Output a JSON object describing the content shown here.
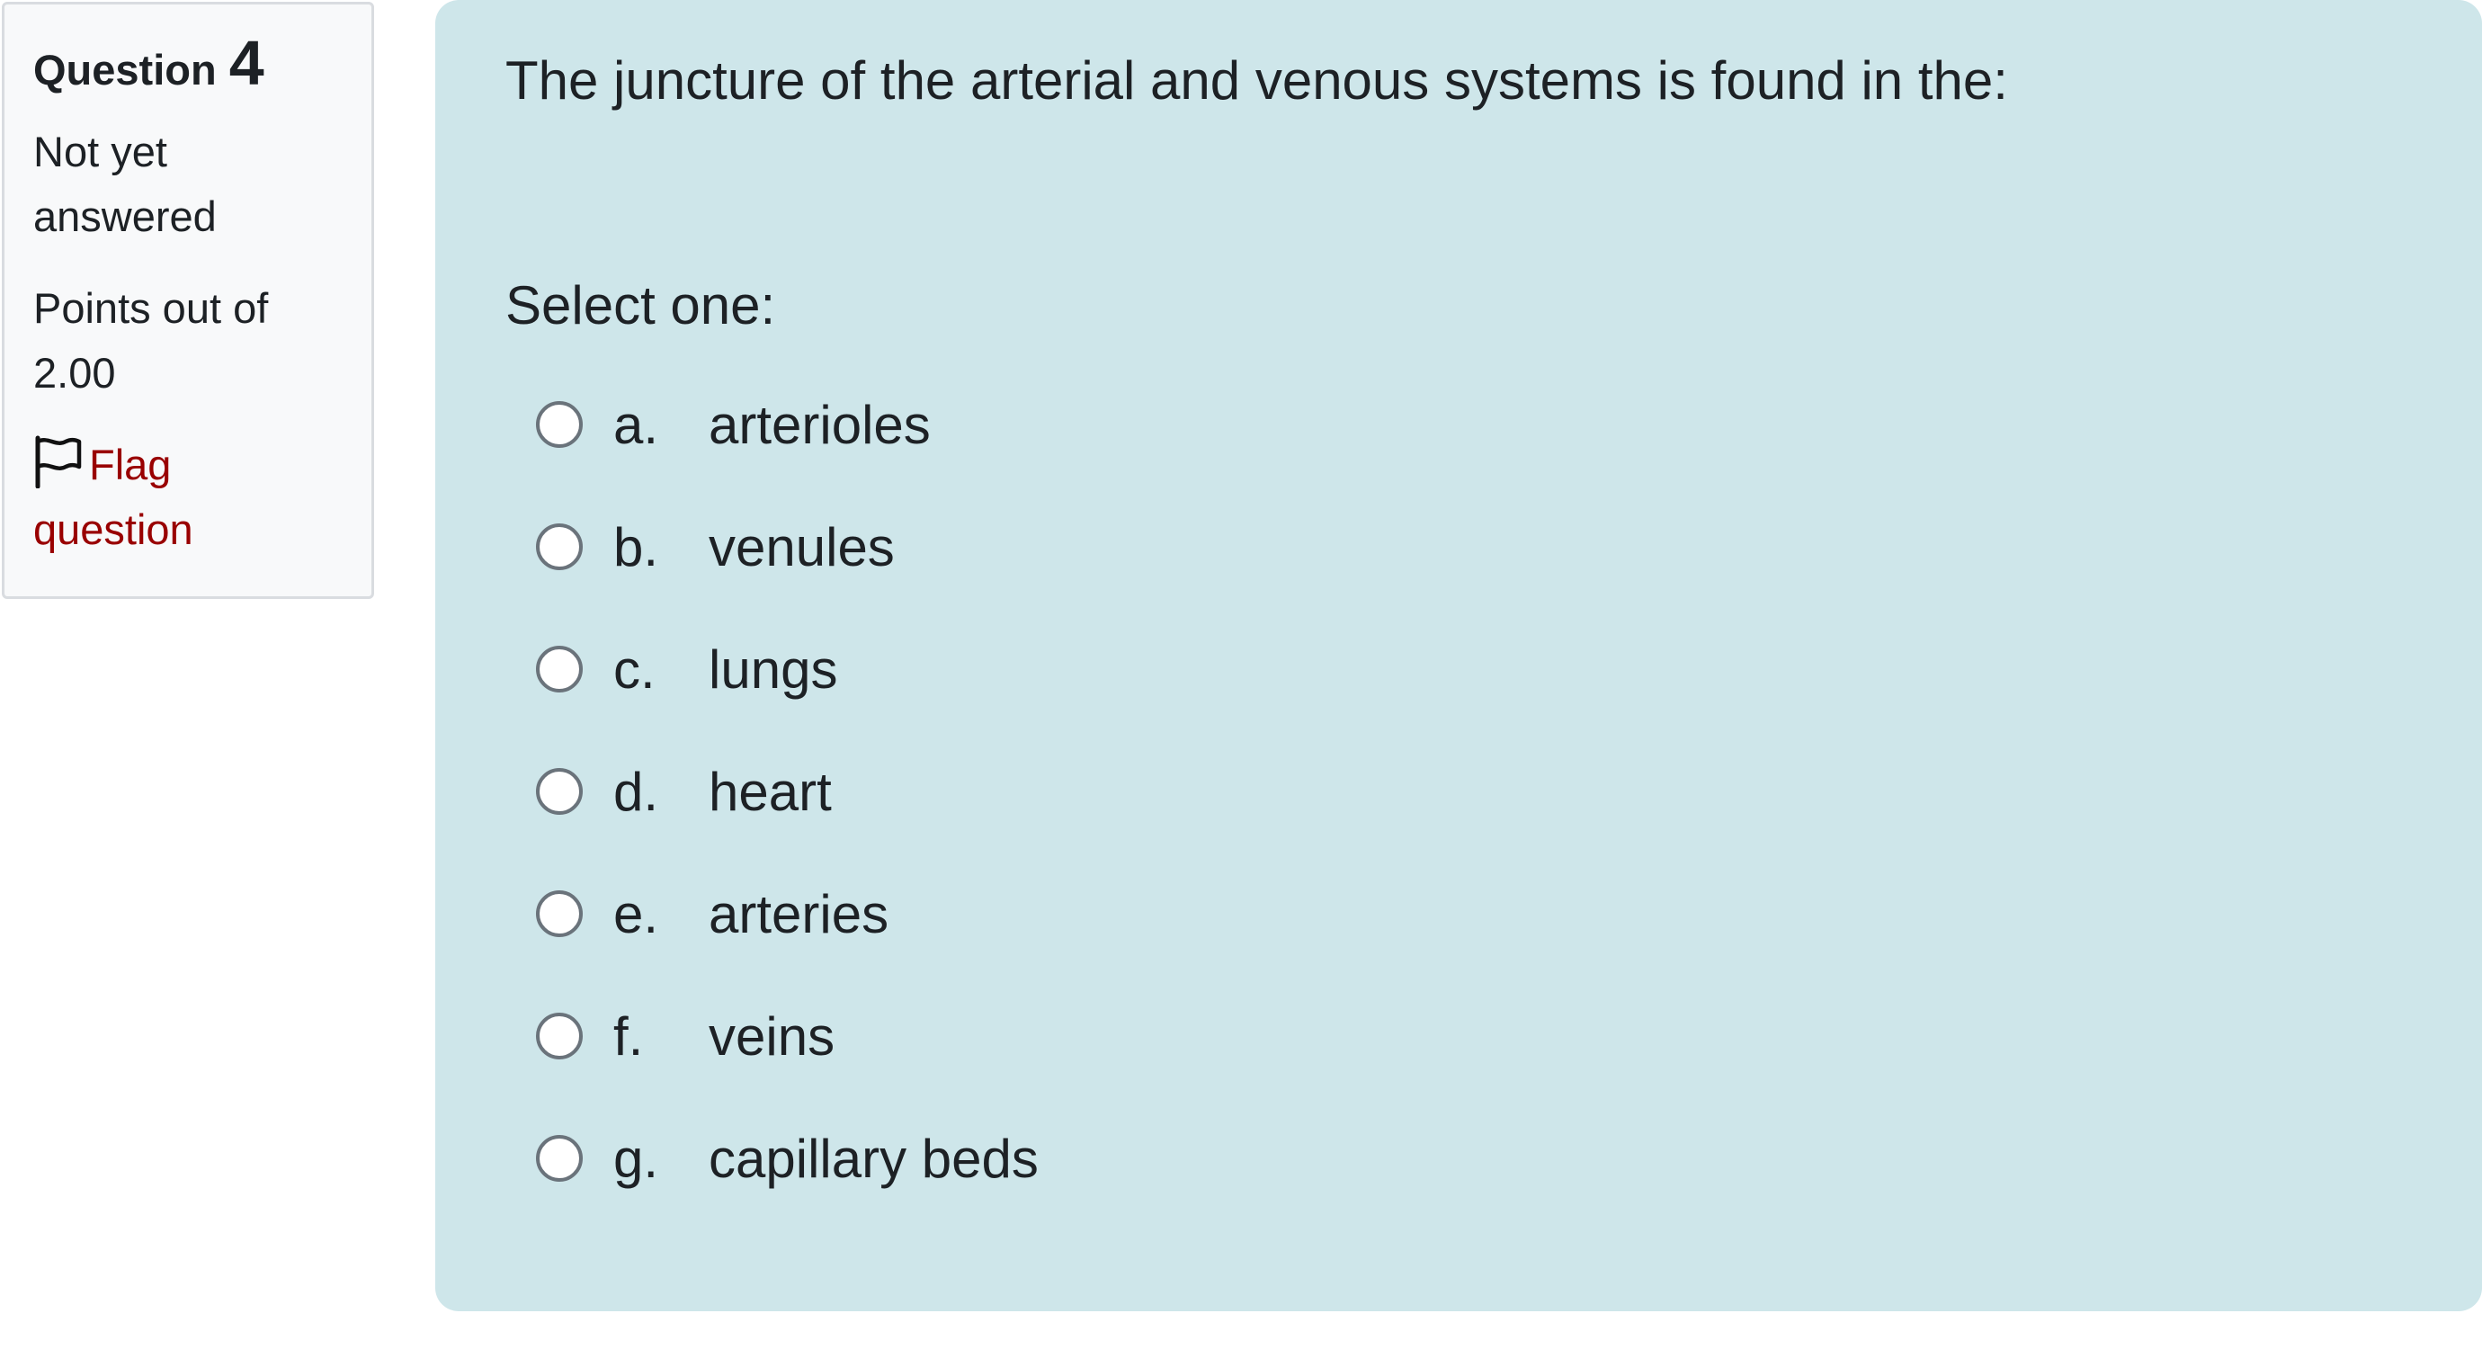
{
  "info": {
    "question_word": "Question",
    "question_number": "4",
    "state_line1": "Not yet",
    "state_line2": "answered",
    "grade_line1": "Points out of",
    "grade_line2": "2.00",
    "flag_line1": "Flag",
    "flag_line2": "question"
  },
  "question": {
    "text": "The juncture of the arterial and venous systems is found in the:",
    "prompt": "Select one:",
    "answers": [
      {
        "letter": "a.",
        "text": "arterioles"
      },
      {
        "letter": "b.",
        "text": "venules"
      },
      {
        "letter": "c.",
        "text": "lungs"
      },
      {
        "letter": "d.",
        "text": "heart"
      },
      {
        "letter": "e.",
        "text": "arteries"
      },
      {
        "letter": "f.",
        "text": "veins"
      },
      {
        "letter": "g.",
        "text": "capillary beds"
      }
    ]
  },
  "icons": {
    "flag": "flag-icon",
    "radio": "radio-unchecked"
  },
  "colors": {
    "panel_bg": "#cee6ea",
    "info_bg": "#f8f9fa",
    "flag_link": "#990000",
    "text": "#1d2125"
  }
}
